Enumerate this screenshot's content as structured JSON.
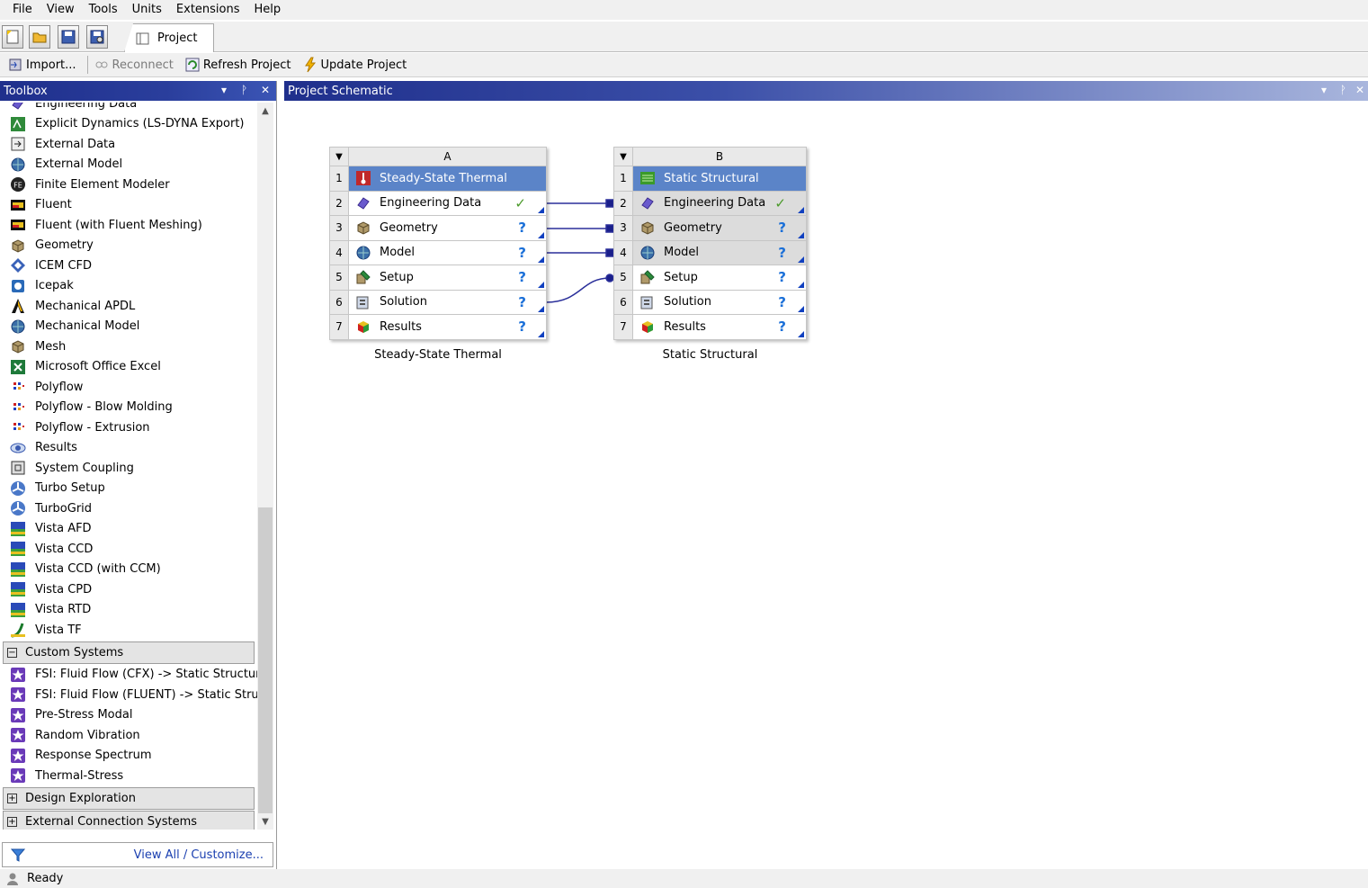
{
  "menu": [
    "File",
    "View",
    "Tools",
    "Units",
    "Extensions",
    "Help"
  ],
  "tab": {
    "label": "Project"
  },
  "toolbar": {
    "import_label": "Import...",
    "reconnect_label": "Reconnect",
    "refresh_label": "Refresh Project",
    "update_label": "Update Project"
  },
  "toolbox": {
    "title": "Toolbox",
    "items": [
      {
        "label": "Engineering Data",
        "icon": "engineering-data-icon"
      },
      {
        "label": "Explicit Dynamics (LS-DYNA Export)",
        "icon": "explicit-dynamics-icon"
      },
      {
        "label": "External Data",
        "icon": "external-data-icon"
      },
      {
        "label": "External Model",
        "icon": "external-model-icon"
      },
      {
        "label": "Finite Element Modeler",
        "icon": "fe-modeler-icon"
      },
      {
        "label": "Fluent",
        "icon": "fluent-icon"
      },
      {
        "label": "Fluent (with Fluent Meshing)",
        "icon": "fluent-icon"
      },
      {
        "label": "Geometry",
        "icon": "geometry-icon"
      },
      {
        "label": "ICEM CFD",
        "icon": "icem-cfd-icon"
      },
      {
        "label": "Icepak",
        "icon": "icepak-icon"
      },
      {
        "label": "Mechanical APDL",
        "icon": "mechanical-apdl-icon"
      },
      {
        "label": "Mechanical Model",
        "icon": "mechanical-model-icon"
      },
      {
        "label": "Mesh",
        "icon": "mesh-icon"
      },
      {
        "label": "Microsoft Office Excel",
        "icon": "excel-icon"
      },
      {
        "label": "Polyflow",
        "icon": "polyflow-icon"
      },
      {
        "label": "Polyflow - Blow Molding",
        "icon": "polyflow-icon"
      },
      {
        "label": "Polyflow - Extrusion",
        "icon": "polyflow-icon"
      },
      {
        "label": "Results",
        "icon": "results-eye-icon"
      },
      {
        "label": "System Coupling",
        "icon": "system-coupling-icon"
      },
      {
        "label": "Turbo Setup",
        "icon": "turbo-icon"
      },
      {
        "label": "TurboGrid",
        "icon": "turbo-icon"
      },
      {
        "label": "Vista AFD",
        "icon": "vista-icon"
      },
      {
        "label": "Vista CCD",
        "icon": "vista-icon"
      },
      {
        "label": "Vista CCD (with CCM)",
        "icon": "vista-icon"
      },
      {
        "label": "Vista CPD",
        "icon": "vista-icon"
      },
      {
        "label": "Vista RTD",
        "icon": "vista-icon"
      },
      {
        "label": "Vista TF",
        "icon": "vista-tf-icon"
      }
    ],
    "custom_group": "Custom Systems",
    "custom_items": [
      "FSI: Fluid Flow (CFX) -> Static Structur",
      "FSI: Fluid Flow (FLUENT) -> Static Stru",
      "Pre-Stress Modal",
      "Random Vibration",
      "Response Spectrum",
      "Thermal-Stress"
    ],
    "design_group": "Design Exploration",
    "external_group": "External Connection Systems",
    "footer_link": "View All / Customize..."
  },
  "schematic": {
    "title": "Project Schematic",
    "systems": [
      {
        "column": "A",
        "caption": "Steady-State Thermal",
        "rows": [
          {
            "num": "1",
            "label": "Steady-State Thermal",
            "status": ""
          },
          {
            "num": "2",
            "label": "Engineering Data",
            "status": "✓"
          },
          {
            "num": "3",
            "label": "Geometry",
            "status": "?"
          },
          {
            "num": "4",
            "label": "Model",
            "status": "?"
          },
          {
            "num": "5",
            "label": "Setup",
            "status": "?"
          },
          {
            "num": "6",
            "label": "Solution",
            "status": "?"
          },
          {
            "num": "7",
            "label": "Results",
            "status": "?"
          }
        ]
      },
      {
        "column": "B",
        "caption": "Static Structural",
        "rows": [
          {
            "num": "1",
            "label": "Static Structural",
            "status": ""
          },
          {
            "num": "2",
            "label": "Engineering Data",
            "status": "✓"
          },
          {
            "num": "3",
            "label": "Geometry",
            "status": "?"
          },
          {
            "num": "4",
            "label": "Model",
            "status": "?"
          },
          {
            "num": "5",
            "label": "Setup",
            "status": "?"
          },
          {
            "num": "6",
            "label": "Solution",
            "status": "?"
          },
          {
            "num": "7",
            "label": "Results",
            "status": "?"
          }
        ]
      }
    ]
  },
  "status": {
    "text": "Ready"
  },
  "colors": {
    "title_bar": "#1f2f8c",
    "selected_row": "#5b84c8",
    "link": "#1a3fb0",
    "check": "#4a9a2a",
    "question": "#1a6fd8"
  }
}
